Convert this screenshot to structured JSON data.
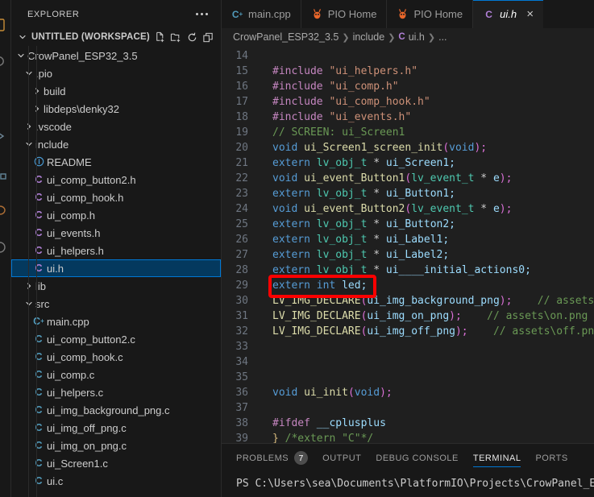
{
  "sidebar": {
    "title": "EXPLORER",
    "workspace": "UNTITLED (WORKSPACE)",
    "actions": [
      {
        "name": "new-file-icon",
        "tooltip": "New File"
      },
      {
        "name": "new-folder-icon",
        "tooltip": "New Folder"
      },
      {
        "name": "refresh-icon",
        "tooltip": "Refresh Explorer"
      },
      {
        "name": "collapse-all-icon",
        "tooltip": "Collapse Folders in Explorer"
      }
    ],
    "tree": [
      {
        "label": "CrowPanel_ESP32_3.5",
        "kind": "folder",
        "expanded": true,
        "depth": 1,
        "icon": ""
      },
      {
        "label": ".pio",
        "kind": "folder",
        "expanded": true,
        "depth": 2,
        "icon": ""
      },
      {
        "label": "build",
        "kind": "folder",
        "expanded": false,
        "depth": 3,
        "icon": ""
      },
      {
        "label": "libdeps\\denky32",
        "kind": "folder",
        "expanded": false,
        "depth": 3,
        "icon": ""
      },
      {
        "label": ".vscode",
        "kind": "folder",
        "expanded": false,
        "depth": 2,
        "icon": ""
      },
      {
        "label": "include",
        "kind": "folder",
        "expanded": true,
        "depth": 2,
        "icon": ""
      },
      {
        "label": "README",
        "kind": "file",
        "depth": 3,
        "icon": "readme"
      },
      {
        "label": "ui_comp_button2.h",
        "kind": "file",
        "depth": 3,
        "icon": "c"
      },
      {
        "label": "ui_comp_hook.h",
        "kind": "file",
        "depth": 3,
        "icon": "c"
      },
      {
        "label": "ui_comp.h",
        "kind": "file",
        "depth": 3,
        "icon": "c"
      },
      {
        "label": "ui_events.h",
        "kind": "file",
        "depth": 3,
        "icon": "c"
      },
      {
        "label": "ui_helpers.h",
        "kind": "file",
        "depth": 3,
        "icon": "c"
      },
      {
        "label": "ui.h",
        "kind": "file",
        "depth": 3,
        "icon": "c",
        "selected": true
      },
      {
        "label": "lib",
        "kind": "folder",
        "expanded": false,
        "depth": 2,
        "icon": ""
      },
      {
        "label": "src",
        "kind": "folder",
        "expanded": true,
        "depth": 2,
        "icon": ""
      },
      {
        "label": "main.cpp",
        "kind": "file",
        "depth": 3,
        "icon": "cpp"
      },
      {
        "label": "ui_comp_button2.c",
        "kind": "file",
        "depth": 3,
        "icon": "csrc"
      },
      {
        "label": "ui_comp_hook.c",
        "kind": "file",
        "depth": 3,
        "icon": "csrc"
      },
      {
        "label": "ui_comp.c",
        "kind": "file",
        "depth": 3,
        "icon": "csrc"
      },
      {
        "label": "ui_helpers.c",
        "kind": "file",
        "depth": 3,
        "icon": "csrc"
      },
      {
        "label": "ui_img_background_png.c",
        "kind": "file",
        "depth": 3,
        "icon": "csrc"
      },
      {
        "label": "ui_img_off_png.c",
        "kind": "file",
        "depth": 3,
        "icon": "csrc"
      },
      {
        "label": "ui_img_on_png.c",
        "kind": "file",
        "depth": 3,
        "icon": "csrc"
      },
      {
        "label": "ui_Screen1.c",
        "kind": "file",
        "depth": 3,
        "icon": "csrc"
      },
      {
        "label": "ui.c",
        "kind": "file",
        "depth": 3,
        "icon": "csrc"
      }
    ]
  },
  "tabs": [
    {
      "label": "main.cpp",
      "icon": "cpp-file-icon",
      "active": false
    },
    {
      "label": "PIO Home",
      "icon": "platformio-icon",
      "active": false
    },
    {
      "label": "PIO Home",
      "icon": "platformio-icon",
      "active": false
    },
    {
      "label": "ui.h",
      "icon": "c-file-icon",
      "active": true
    }
  ],
  "breadcrumb": {
    "parts": [
      "CrowPanel_ESP32_3.5",
      "include",
      "ui.h",
      "..."
    ],
    "file_icon_letter": "C"
  },
  "editor": {
    "first_line": 14,
    "lines": [
      {
        "n": 14,
        "tokens": []
      },
      {
        "n": 15,
        "tokens": [
          {
            "t": "#include ",
            "c": "kw2"
          },
          {
            "t": "\"ui_helpers.h\"",
            "c": "str"
          }
        ]
      },
      {
        "n": 16,
        "tokens": [
          {
            "t": "#include ",
            "c": "kw2"
          },
          {
            "t": "\"ui_comp.h\"",
            "c": "str"
          }
        ]
      },
      {
        "n": 17,
        "tokens": [
          {
            "t": "#include ",
            "c": "kw2"
          },
          {
            "t": "\"ui_comp_hook.h\"",
            "c": "str"
          }
        ]
      },
      {
        "n": 18,
        "tokens": [
          {
            "t": "#include ",
            "c": "kw2"
          },
          {
            "t": "\"ui_events.h\"",
            "c": "str"
          }
        ]
      },
      {
        "n": 19,
        "tokens": [
          {
            "t": "// SCREEN: ui_Screen1",
            "c": "cmt"
          }
        ]
      },
      {
        "n": 20,
        "tokens": [
          {
            "t": "void ",
            "c": "kw"
          },
          {
            "t": "ui_Screen1_screen_init",
            "c": "fn"
          },
          {
            "t": "(",
            "c": "punct"
          },
          {
            "t": "void",
            "c": "kw"
          },
          {
            "t": ");",
            "c": "punct"
          }
        ]
      },
      {
        "n": 21,
        "tokens": [
          {
            "t": "extern ",
            "c": "kw"
          },
          {
            "t": "lv_obj_t",
            "c": "type"
          },
          {
            "t": " * ",
            "c": "pl"
          },
          {
            "t": "ui_Screen1;",
            "c": "var"
          }
        ]
      },
      {
        "n": 22,
        "tokens": [
          {
            "t": "void ",
            "c": "kw"
          },
          {
            "t": "ui_event_Button1",
            "c": "fn"
          },
          {
            "t": "(",
            "c": "punct"
          },
          {
            "t": "lv_event_t",
            "c": "type"
          },
          {
            "t": " * ",
            "c": "pl"
          },
          {
            "t": "e",
            "c": "var"
          },
          {
            "t": ");",
            "c": "punct"
          }
        ]
      },
      {
        "n": 23,
        "tokens": [
          {
            "t": "extern ",
            "c": "kw"
          },
          {
            "t": "lv_obj_t",
            "c": "type"
          },
          {
            "t": " * ",
            "c": "pl"
          },
          {
            "t": "ui_Button1;",
            "c": "var"
          }
        ]
      },
      {
        "n": 24,
        "tokens": [
          {
            "t": "void ",
            "c": "kw"
          },
          {
            "t": "ui_event_Button2",
            "c": "fn"
          },
          {
            "t": "(",
            "c": "punct"
          },
          {
            "t": "lv_event_t",
            "c": "type"
          },
          {
            "t": " * ",
            "c": "pl"
          },
          {
            "t": "e",
            "c": "var"
          },
          {
            "t": ");",
            "c": "punct"
          }
        ]
      },
      {
        "n": 25,
        "tokens": [
          {
            "t": "extern ",
            "c": "kw"
          },
          {
            "t": "lv_obj_t",
            "c": "type"
          },
          {
            "t": " * ",
            "c": "pl"
          },
          {
            "t": "ui_Button2;",
            "c": "var"
          }
        ]
      },
      {
        "n": 26,
        "tokens": [
          {
            "t": "extern ",
            "c": "kw"
          },
          {
            "t": "lv_obj_t",
            "c": "type"
          },
          {
            "t": " * ",
            "c": "pl"
          },
          {
            "t": "ui_Label1;",
            "c": "var"
          }
        ]
      },
      {
        "n": 27,
        "tokens": [
          {
            "t": "extern ",
            "c": "kw"
          },
          {
            "t": "lv_obj_t",
            "c": "type"
          },
          {
            "t": " * ",
            "c": "pl"
          },
          {
            "t": "ui_Label2;",
            "c": "var"
          }
        ]
      },
      {
        "n": 28,
        "tokens": [
          {
            "t": "extern ",
            "c": "kw"
          },
          {
            "t": "lv_obj_t",
            "c": "type"
          },
          {
            "t": " * ",
            "c": "pl"
          },
          {
            "t": "ui____initial_actions0;",
            "c": "var"
          }
        ]
      },
      {
        "n": 29,
        "tokens": [
          {
            "t": "extern ",
            "c": "kw"
          },
          {
            "t": "int ",
            "c": "kw"
          },
          {
            "t": "led;",
            "c": "var"
          }
        ],
        "highlighted": true
      },
      {
        "n": 30,
        "tokens": [
          {
            "t": "LV_IMG_DECLARE",
            "c": "fn"
          },
          {
            "t": "(",
            "c": "punct"
          },
          {
            "t": "ui_img_background_png",
            "c": "var"
          },
          {
            "t": ");",
            "c": "punct"
          },
          {
            "t": "    ",
            "c": "pl"
          },
          {
            "t": "// assets\\",
            "c": "cmt"
          }
        ]
      },
      {
        "n": 31,
        "tokens": [
          {
            "t": "LV_IMG_DECLARE",
            "c": "fn"
          },
          {
            "t": "(",
            "c": "punct"
          },
          {
            "t": "ui_img_on_png",
            "c": "var"
          },
          {
            "t": ");",
            "c": "punct"
          },
          {
            "t": "    ",
            "c": "pl"
          },
          {
            "t": "// assets\\on.png",
            "c": "cmt"
          }
        ]
      },
      {
        "n": 32,
        "tokens": [
          {
            "t": "LV_IMG_DECLARE",
            "c": "fn"
          },
          {
            "t": "(",
            "c": "punct"
          },
          {
            "t": "ui_img_off_png",
            "c": "var"
          },
          {
            "t": ");",
            "c": "punct"
          },
          {
            "t": "    ",
            "c": "pl"
          },
          {
            "t": "// assets\\off.png",
            "c": "cmt"
          }
        ]
      },
      {
        "n": 33,
        "tokens": []
      },
      {
        "n": 34,
        "tokens": []
      },
      {
        "n": 35,
        "tokens": []
      },
      {
        "n": 36,
        "tokens": [
          {
            "t": "void ",
            "c": "kw"
          },
          {
            "t": "ui_init",
            "c": "fn"
          },
          {
            "t": "(",
            "c": "punct"
          },
          {
            "t": "void",
            "c": "kw"
          },
          {
            "t": ");",
            "c": "punct"
          }
        ]
      },
      {
        "n": 37,
        "tokens": []
      },
      {
        "n": 38,
        "tokens": [
          {
            "t": "#ifdef ",
            "c": "kw2"
          },
          {
            "t": "__cplusplus",
            "c": "var"
          }
        ]
      },
      {
        "n": 39,
        "tokens": [
          {
            "t": "}",
            "c": "brace"
          },
          {
            "t": " /*extern ",
            "c": "cmt"
          },
          {
            "t": "\"C\"",
            "c": "cmt"
          },
          {
            "t": "*/",
            "c": "cmt"
          }
        ]
      }
    ],
    "annotation": {
      "name": "red-highlight-rectangle",
      "color": "#fe0000",
      "line": 29,
      "text": "extern int led;"
    }
  },
  "panel": {
    "tabs": [
      {
        "label": "PROBLEMS",
        "badge": "7",
        "active": false
      },
      {
        "label": "OUTPUT",
        "badge": "",
        "active": false
      },
      {
        "label": "DEBUG CONSOLE",
        "badge": "",
        "active": false
      },
      {
        "label": "TERMINAL",
        "badge": "",
        "active": true
      },
      {
        "label": "PORTS",
        "badge": "",
        "active": false
      }
    ],
    "terminal_lines": [
      "PS C:\\Users\\sea\\Documents\\PlatformIO\\Projects\\CrowPanel_ES"
    ]
  },
  "colors": {
    "accent": "#0078d4",
    "selection": "#04395e",
    "editor_bg": "#1f1f1f",
    "sidebar_bg": "#181818",
    "annotation": "#fe0000"
  }
}
